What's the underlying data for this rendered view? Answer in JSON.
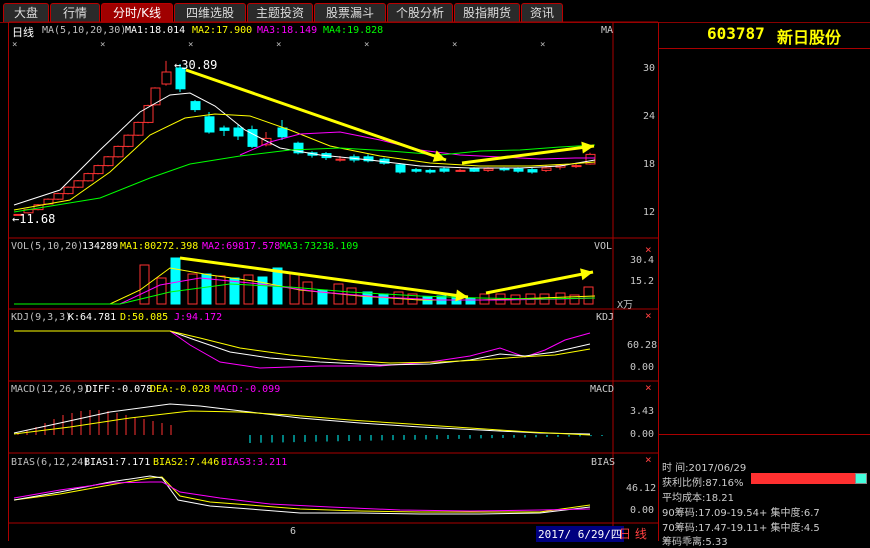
{
  "tabs": [
    "大盘",
    "行情",
    "分时/K线",
    "四维选股",
    "主题投资",
    "股票漏斗",
    "个股分析",
    "股指期货",
    "资讯"
  ],
  "active_tab": 2,
  "stock": {
    "code": "603787",
    "name": "新日股份"
  },
  "kline": {
    "header": {
      "period": "日线",
      "ma": "MA(5,10,20,30)",
      "ma1": "MA1:18.014",
      "ma2": "MA2:17.900",
      "ma3": "MA3:18.149",
      "ma4": "MA4:19.828"
    },
    "corner": "MA",
    "high_label": "30.89",
    "low_label": "11.68",
    "y_ticks": [
      "30",
      "24",
      "18",
      "12"
    ]
  },
  "vol": {
    "header": "VOL(5,10,20)",
    "value": "134289",
    "ma1": "MA1:80272.398",
    "ma2": "MA2:69817.578",
    "ma3": "MA3:73238.109",
    "corner": "VOL",
    "y_ticks": [
      "30.4",
      "15.2"
    ],
    "unit": "X万"
  },
  "kdj": {
    "header": "KDJ(9,3,3)",
    "k": "K:64.781",
    "d": "D:50.085",
    "j": "J:94.172",
    "corner": "KDJ",
    "y_ticks": [
      "60.28",
      "0.00"
    ]
  },
  "macd": {
    "header": "MACD(12,26,9)",
    "diff": "DIFF:-0.078",
    "dea": "DEA:-0.028",
    "macd": "MACD:-0.099",
    "corner": "MACD",
    "y_ticks": [
      "3.43",
      "0.00"
    ]
  },
  "bias": {
    "header": "BIAS(6,12,24)",
    "b1": "BIAS1:7.171",
    "b2": "BIAS2:7.446",
    "b3": "BIAS3:3.211",
    "corner": "BIAS",
    "y_ticks": [
      "46.12",
      "0.00"
    ]
  },
  "bottom": {
    "month": "6",
    "date": "2017/ 6/29/四",
    "period_btn": "日 线"
  },
  "chips": {
    "time": "时   间:2017/06/29",
    "profit": "获利比例:87.16%",
    "avg": "平均成本:18.21",
    "c90": "90筹码:17.09-19.54+ 集中度:6.7",
    "c70": "70筹码:17.47-19.11+ 集中度:4.5",
    "ratio": "筹码乖离:5.33"
  },
  "colors": {
    "up": "#ff3232",
    "down": "#00ffff",
    "ma1": "#ffffff",
    "ma2": "#ffff00",
    "ma3": "#ff00ff",
    "ma4": "#00ff00",
    "arrow": "#ffff00",
    "border": "#aa0000"
  }
}
